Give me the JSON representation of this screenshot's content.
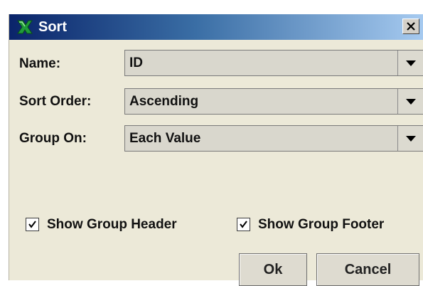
{
  "dialog": {
    "title": "Sort",
    "title_icon": "sort-app-icon",
    "close_icon": "close-icon"
  },
  "fields": [
    {
      "label": "Name:",
      "value": "ID"
    },
    {
      "label": "Sort Order:",
      "value": "Ascending"
    },
    {
      "label": "Group On:",
      "value": "Each Value"
    }
  ],
  "options": {
    "show_group_header": {
      "label": "Show Group Header",
      "checked": true
    },
    "show_group_footer": {
      "label": "Show Group Footer",
      "checked": true
    }
  },
  "buttons": {
    "ok": "Ok",
    "cancel": "Cancel"
  },
  "colors": {
    "titlebar_start": "#0a246a",
    "titlebar_end": "#a6caf0",
    "dialog_bg": "#ece9d8"
  }
}
